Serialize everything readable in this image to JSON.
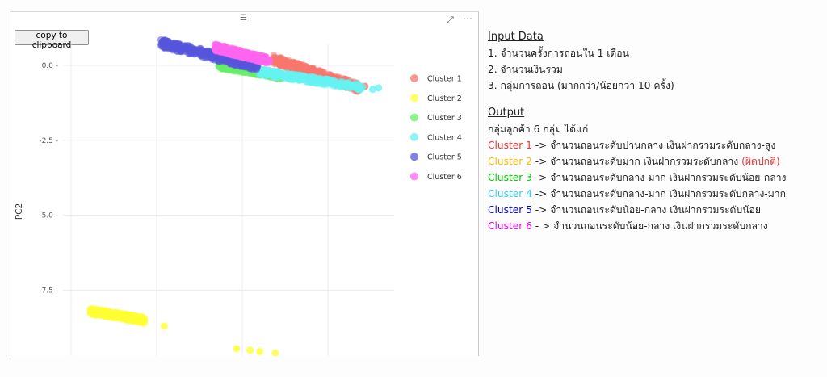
{
  "visual": {
    "copy_button_label": "copy to clipboard",
    "drag_handle_icon": "drag-handle-icon",
    "focus_icon": "focus-mode-icon",
    "more_icon": "more-options-icon"
  },
  "chart_data": {
    "type": "scatter",
    "ylabel": "PC2",
    "xlabel": "",
    "ylim": [
      -9.7,
      0.7
    ],
    "y_ticks": [
      0.0,
      -2.5,
      -5.0,
      -7.5
    ],
    "y_tick_labels": [
      "0.0 -",
      "-2.5 -",
      "-5.0 -",
      "-7.5 -"
    ],
    "x_grid_count": 4,
    "grid": true,
    "legend_position": "right",
    "series": [
      {
        "name": "Cluster 1",
        "color": "#f8766d",
        "band": {
          "x": [
            1.4,
            3.6
          ],
          "y": [
            0.2,
            -0.75
          ],
          "spread": 0.14
        },
        "points": [
          {
            "x": 3.65,
            "y": -0.72
          },
          {
            "x": 3.75,
            "y": -0.7
          }
        ]
      },
      {
        "name": "Cluster 2",
        "color": "#ffff33",
        "band": {
          "x": [
            -3.3,
            -1.9
          ],
          "y": [
            -8.2,
            -8.5
          ],
          "spread": 0.1
        },
        "points": [
          {
            "x": -1.4,
            "y": -8.7
          },
          {
            "x": 0.45,
            "y": -9.45
          },
          {
            "x": 0.8,
            "y": -9.5
          },
          {
            "x": 1.05,
            "y": -9.55
          },
          {
            "x": 1.45,
            "y": -9.6
          }
        ]
      },
      {
        "name": "Cluster 3",
        "color": "#66ee66",
        "band": {
          "x": [
            0.0,
            1.6
          ],
          "y": [
            0.0,
            -0.35
          ],
          "spread": 0.1
        },
        "points": []
      },
      {
        "name": "Cluster 4",
        "color": "#66f2f2",
        "band": {
          "x": [
            1.0,
            3.7
          ],
          "y": [
            -0.2,
            -0.75
          ],
          "spread": 0.1
        },
        "points": [
          {
            "x": 3.95,
            "y": -0.8
          },
          {
            "x": 4.1,
            "y": -0.75
          }
        ]
      },
      {
        "name": "Cluster 5",
        "color": "#5555dd",
        "band": {
          "x": [
            -1.5,
            1.0
          ],
          "y": [
            0.75,
            -0.05
          ],
          "spread": 0.14
        },
        "points": []
      },
      {
        "name": "Cluster 6",
        "color": "#ff66ee",
        "band": {
          "x": [
            -0.1,
            1.3
          ],
          "y": [
            0.6,
            0.15
          ],
          "spread": 0.11
        },
        "points": []
      }
    ]
  },
  "side": {
    "input_heading": "Input Data",
    "input_items": [
      "1. จำนวนครั้งการถอนใน 1 เดือน",
      "2. จำนวนเงินรวม",
      "3. กลุ่มการถอน (มากกว่า/น้อยกว่า 10 ครั้ง)"
    ],
    "output_heading": "Output",
    "output_intro": "กลุ่มลูกค้า 6 กลุ่ม ได้แก่",
    "clusters": [
      {
        "name": "Cluster 1",
        "color": "#ee3333",
        "desc": " -> จำนวนถอนระดับปานกลาง เงินฝากรวมระดับกลาง-สูง",
        "note": ""
      },
      {
        "name": "Cluster 2",
        "color": "#ffbb00",
        "desc": " -> จำนวนถอนระดับมาก เงินฝากรวมระดับกลาง ",
        "note": "(ผิดปกติ)",
        "note_color": "#ee3333"
      },
      {
        "name": "Cluster 3",
        "color": "#00cc00",
        "desc": " -> จำนวนถอนระดับกลาง-มาก เงินฝากรวมระดับน้อย-กลาง",
        "note": ""
      },
      {
        "name": "Cluster 4",
        "color": "#33ccee",
        "desc": " -> จำนวนถอนระดับกลาง-มาก เงินฝากรวมระดับกลาง-มาก",
        "note": ""
      },
      {
        "name": "Cluster 5",
        "color": "#0000cc",
        "desc": " -> จำนวนถอนระดับน้อย-กลาง เงินฝากรวมระดับน้อย",
        "note": ""
      },
      {
        "name": "Cluster 6",
        "color": "#ee00ee",
        "desc": " - > จำนวนถอนระดับน้อย-กลาง เงินฝากรวมระดับกลาง",
        "note": ""
      }
    ]
  }
}
